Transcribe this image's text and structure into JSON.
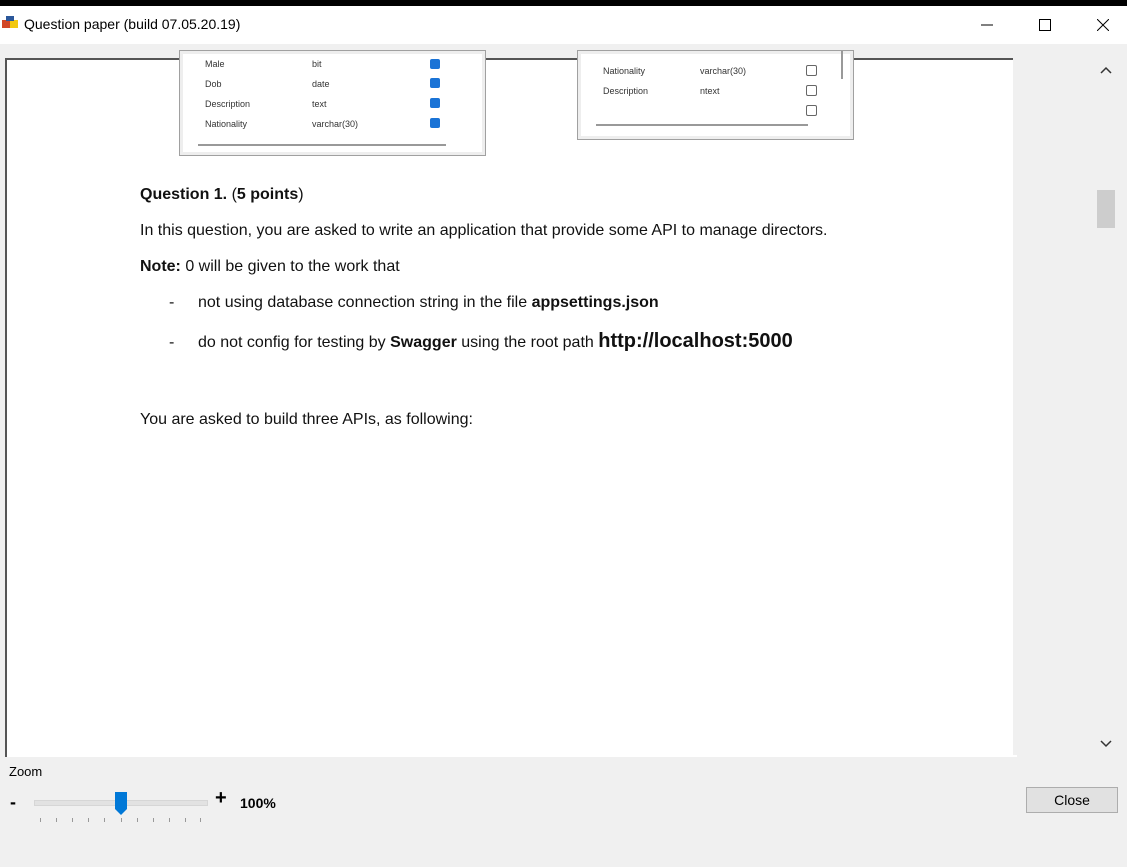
{
  "window": {
    "title": "Question paper (build 07.05.20.19)"
  },
  "table_left": {
    "rows": [
      {
        "name": "Male",
        "type": "bit",
        "checked": true
      },
      {
        "name": "Dob",
        "type": "date",
        "checked": true
      },
      {
        "name": "Description",
        "type": "text",
        "checked": true
      },
      {
        "name": "Nationality",
        "type": "varchar(30)",
        "checked": true
      }
    ]
  },
  "table_right": {
    "rows": [
      {
        "name": "Nationality",
        "type": "varchar(30)",
        "checked": false
      },
      {
        "name": "Description",
        "type": "ntext",
        "checked": false
      },
      {
        "name": "",
        "type": "",
        "checked": false
      }
    ]
  },
  "content": {
    "q_label": "Question 1.",
    "q_paren_open": "(",
    "q_points": "5 points",
    "q_paren_close": ")",
    "intro": "In this question, you are asked to write an application that provide some API to manage directors.",
    "note_label": "Note:",
    "note_text": " 0 will be given to the work that",
    "bullet1_dash": "-",
    "bullet1_text": "not using database connection string in the file ",
    "bullet1_bold": "appsettings.json",
    "bullet2_dash": "-",
    "bullet2_text1": "do not config for testing by ",
    "bullet2_bold": "Swagger",
    "bullet2_text2": " using the root path ",
    "bullet2_url": "http://localhost:5000",
    "apis_intro": "You are asked to build three APIs, as following:"
  },
  "zoom": {
    "label": "Zoom",
    "minus": "-",
    "plus": "+",
    "value_text": "100%",
    "slider_fraction": 0.5
  },
  "close_button": "Close"
}
